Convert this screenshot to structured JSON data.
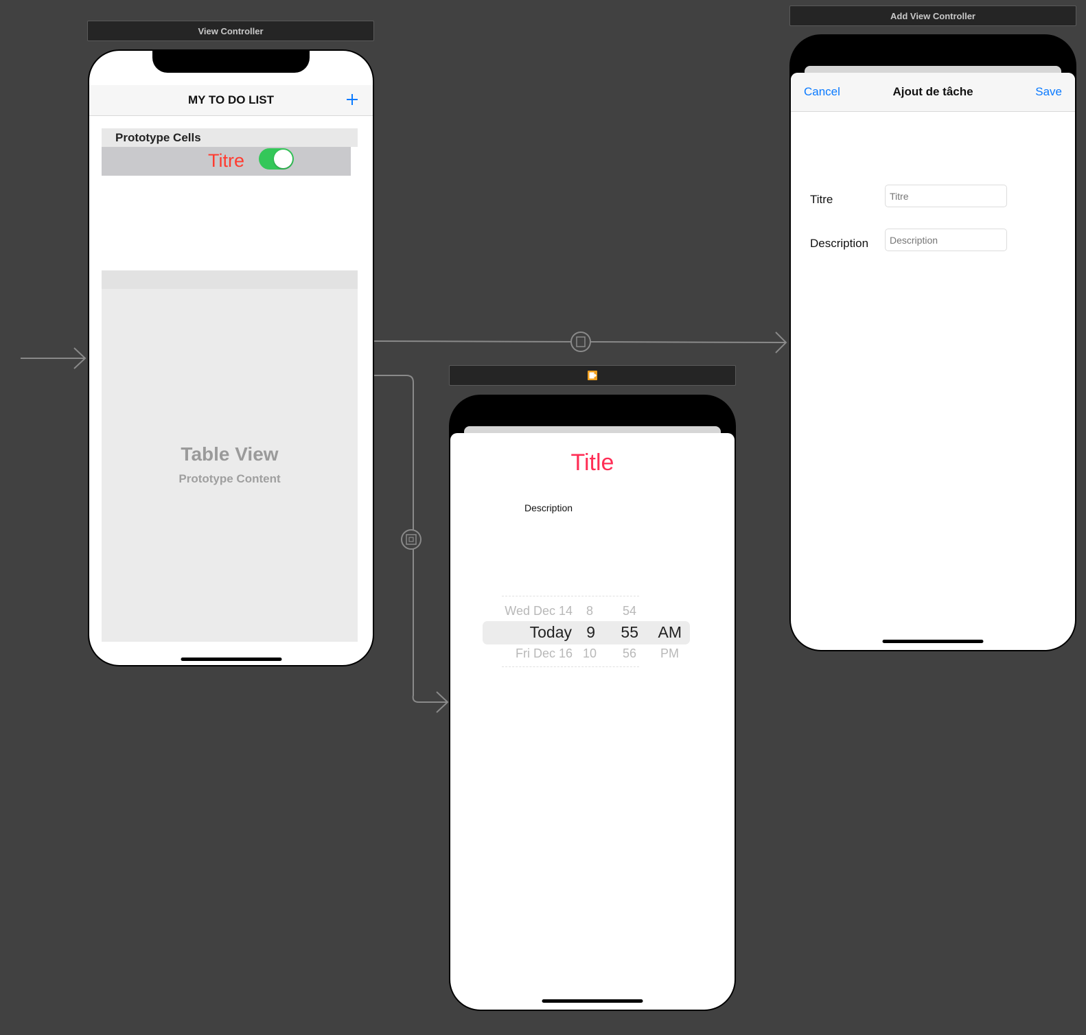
{
  "scenes": {
    "view_controller": {
      "scene_title": "View Controller",
      "nav_title": "MY TO DO LIST",
      "add_icon": "plus-icon",
      "prototype_cells_header": "Prototype Cells",
      "cell_title": "Titre",
      "cell_switch_on": true,
      "table_view_label": "Table View",
      "table_view_sublabel": "Prototype Content"
    },
    "add_view_controller": {
      "scene_title": "Add View Controller",
      "cancel_label": "Cancel",
      "nav_title": "Ajout de tâche",
      "save_label": "Save",
      "title_label": "Titre",
      "title_placeholder": "Titre",
      "description_label": "Description",
      "description_placeholder": "Description"
    },
    "detail_view_controller": {
      "dock_icons": [
        "view-controller-icon",
        "first-responder-icon",
        "exit-icon"
      ],
      "title": "Title",
      "description": "Description",
      "picker": {
        "rows_above": {
          "date": "Wed Dec 14",
          "hour": "8",
          "minute": "54"
        },
        "selected": {
          "date": "Today",
          "hour": "9",
          "minute": "55",
          "ampm": "AM"
        },
        "rows_below": {
          "date": "Fri Dec 16",
          "hour": "10",
          "minute": "56",
          "ampm": "PM"
        }
      }
    }
  },
  "colors": {
    "canvas": "#414141",
    "accent_blue": "#0a7aff",
    "cell_title_red": "#ff3b30",
    "title_pink": "#ff2d55",
    "switch_green": "#34c759"
  }
}
